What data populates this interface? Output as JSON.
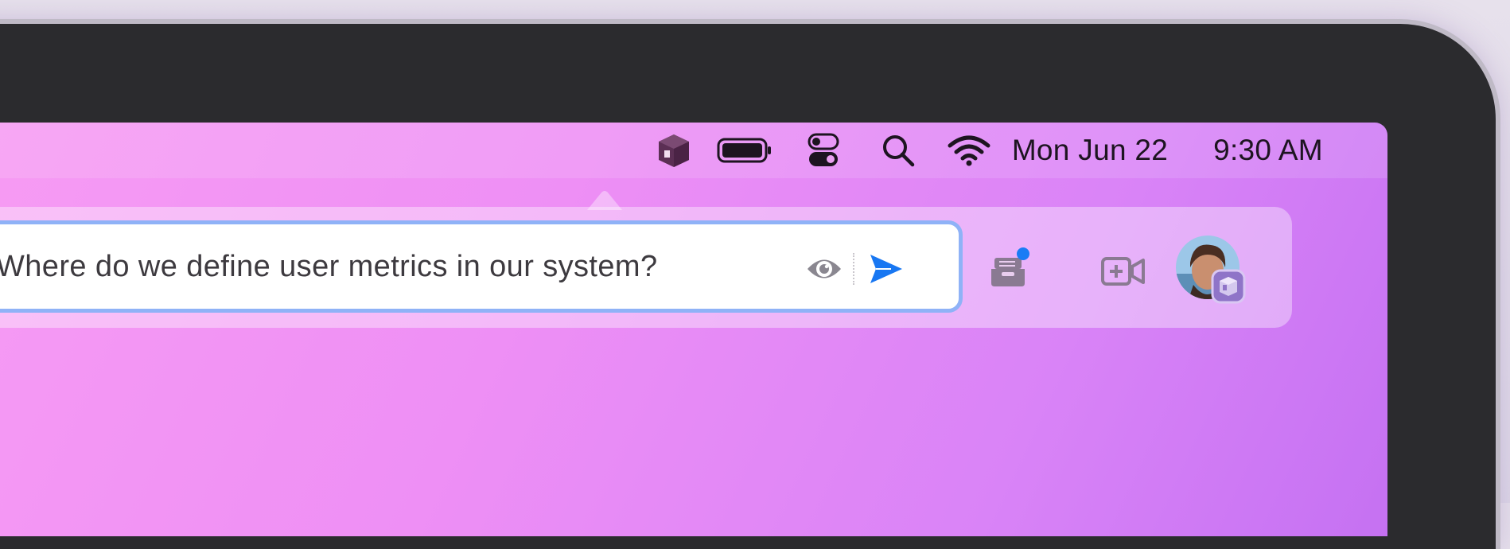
{
  "menubar": {
    "date": "Mon Jun 22",
    "time": "9:30 AM",
    "icons": [
      "app-cube-icon",
      "battery-icon",
      "control-center-icon",
      "search-icon",
      "wifi-icon"
    ]
  },
  "popover": {
    "query_value": "Where do we define user metrics in our system?",
    "actions": [
      "privacy-eye-icon",
      "send-icon",
      "inbox-icon",
      "add-meeting-icon",
      "user-avatar"
    ],
    "accent": "#1877f2",
    "notification_color": "#1a7cf5"
  }
}
